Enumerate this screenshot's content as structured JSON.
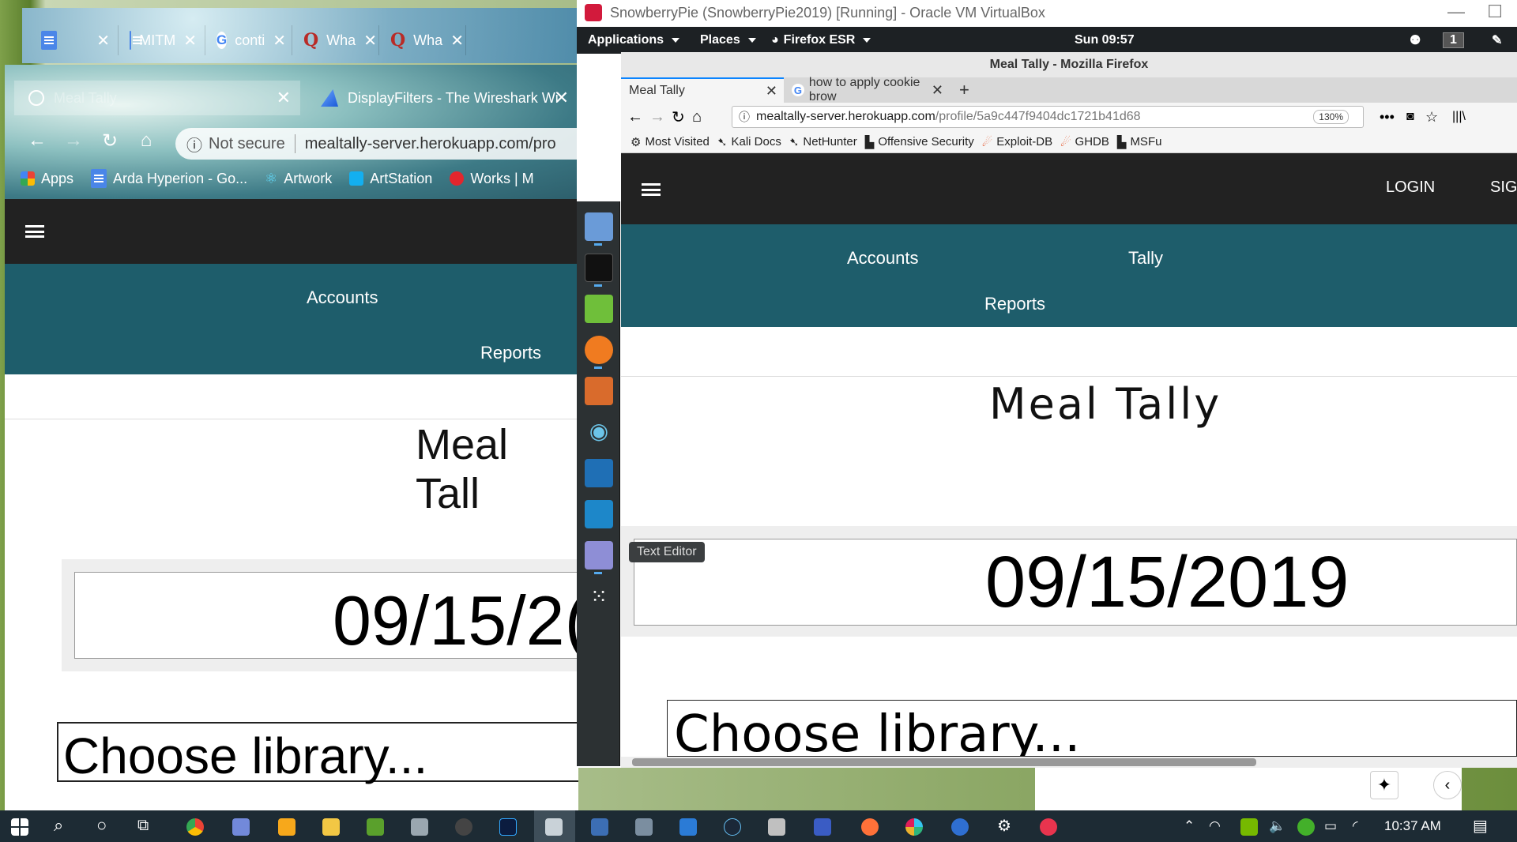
{
  "back_chrome": {
    "tabs": [
      {
        "label": "",
        "icon": "docs-icon"
      },
      {
        "label": "MITM",
        "icon": "docs-icon"
      },
      {
        "label": "conti",
        "icon": "google-icon"
      },
      {
        "label": "Wha",
        "icon": "quora-icon"
      },
      {
        "label": "Wha",
        "icon": "quora-icon"
      }
    ],
    "close": "✕"
  },
  "front_chrome": {
    "tabs": [
      {
        "label": "Meal Tally"
      },
      {
        "label": "DisplayFilters - The Wireshark Wi"
      }
    ],
    "close": "✕",
    "not_secure": "Not secure",
    "url": "mealtally-server.herokuapp.com/pro",
    "bookmarks": [
      "Apps",
      "Arda Hyperion - Go...",
      "Artwork",
      "ArtStation",
      "Works | M"
    ],
    "nav": [
      "Accounts",
      "Reports"
    ],
    "title": "Meal Tall",
    "date": "09/15/2(",
    "library_placeholder": "Choose library..."
  },
  "vbox": {
    "title": "SnowberryPie (SnowberryPie2019) [Running] - Oracle VM VirtualBox",
    "kali_menu": [
      "Applications",
      "Places",
      "Firefox ESR"
    ],
    "clock": "Sun 09:57",
    "workspace": "1"
  },
  "firefox": {
    "window_title": "Meal Tally - Mozilla Firefox",
    "tabs": [
      {
        "label": "Meal Tally"
      },
      {
        "label": "how to apply cookie brow"
      }
    ],
    "new_tab": "+",
    "close": "✕",
    "url_host": "mealtally-server.herokuapp.com",
    "url_path": "/profile/5a9c447f9404dc1721b41d68",
    "zoom": "130%",
    "bookmarks": [
      "Most Visited",
      "Kali Docs",
      "NetHunter",
      "Offensive Security",
      "Exploit-DB",
      "GHDB",
      "MSFu"
    ],
    "login": "LOGIN",
    "signup": "SIGN",
    "nav": [
      "Accounts",
      "Tally",
      "Reports"
    ],
    "title": "Meal Tally",
    "date": "09/15/2019",
    "library_placeholder": "Choose library...",
    "tooltip": "Text Editor"
  },
  "taskbar": {
    "time": "10:37 AM"
  },
  "colors": {
    "teal": "#1e5d6b",
    "appbar": "#222222",
    "taskbar": "#1d2b34"
  }
}
